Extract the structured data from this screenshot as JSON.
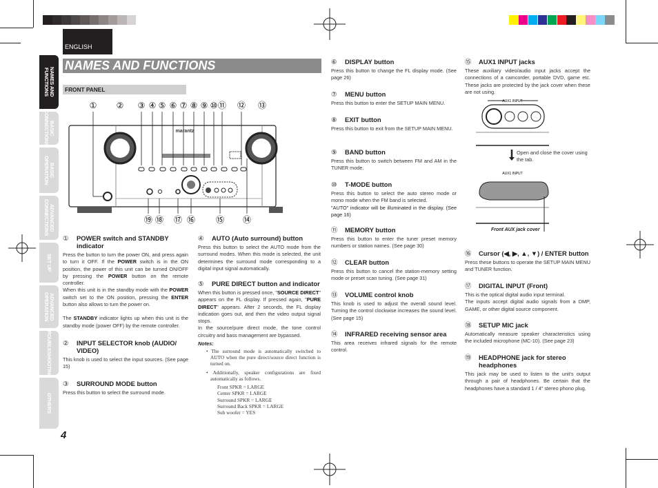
{
  "colors": {
    "grayscale": [
      "#231f20",
      "#2f2b2c",
      "#3d3839",
      "#4e4849",
      "#5f5859",
      "#756d6e",
      "#8c8485",
      "#a39c9d",
      "#bcb6b7",
      "#d7d2d3"
    ],
    "process": [
      "#fff200",
      "#ec008c",
      "#00aeef",
      "#2e3192",
      "#00a651",
      "#ed1c24",
      "#231f20",
      "#fff57a",
      "#f68fc8",
      "#7dd8f7",
      "#8c8c8c"
    ]
  },
  "header": {
    "language": "ENGLISH",
    "title": "NAMES AND FUNCTIONS",
    "section": "FRONT PANEL"
  },
  "side_tabs": [
    "NAMES AND FUNCTIONS",
    "BASIC CONNECTIONS",
    "BASIC OPERATION",
    "ADVANCED CONNECTIONS",
    "SET UP",
    "ADVANCED OPERATION",
    "TROUBLESHOOTING",
    "OTHERS"
  ],
  "diagram": {
    "callouts_top": [
      "①",
      "②",
      "③",
      "④",
      "⑤",
      "⑥",
      "⑦",
      "⑧",
      "⑨",
      "⑩",
      "⑪",
      "⑫",
      "⑬"
    ],
    "callouts_bottom": [
      "⑲",
      "⑱",
      "⑰",
      "⑯",
      "⑮",
      "⑭"
    ],
    "brand": "marantz"
  },
  "items": [
    {
      "num": "①",
      "title": "POWER switch and STANDBY indicator",
      "body": [
        "Press the button to turn the power ON, and press again to turn it OFF. If the POWER switch is in the ON position, the power of this unit can be turned ON/OFF by pressing the POWER button on the remote controller.",
        "When this unit is in the standby mode with the POWER switch set to the ON position, pressing the ENTER button also allows to turn the power on.",
        "The STANDBY indicator lights up when this unit is the standby mode (power OFF) by the remote controller."
      ]
    },
    {
      "num": "②",
      "title": "INPUT SELECTOR knob (AUDIO/ VIDEO)",
      "body": [
        "This knob is used to select the input sources. (See page 15)"
      ]
    },
    {
      "num": "③",
      "title": "SURROUND MODE button",
      "body": [
        "Press this button to select the surround mode."
      ]
    },
    {
      "num": "④",
      "title": "AUTO (Auto surround) button",
      "body": [
        "Press this button to select the AUTO mode from the surround modes. When this mode is selected, the unit determines the surround mode corresponding to a digital input signal automatically."
      ]
    },
    {
      "num": "⑤",
      "title": "PURE DIRECT button and indicator",
      "body": [
        "When this button is pressed once, \"SOURCE DIRECT\" appears on the FL display. If pressed again, \"PURE DIRECT\" appears. After 2 seconds, the FL display indication goes out, and then the video output signal stops.",
        "In the source/pure direct mode, the tone control circuitry and bass management are bypassed."
      ],
      "notes_label": "Notes:",
      "notes": [
        "The surround mode is automatically switched to AUTO when the pure direct/source direct function is turned on.",
        "Additionally, speaker configurations are fixed automatically as follows."
      ],
      "speakers": [
        "Front SPKR = LARGE",
        "Center SPKR = LARGE",
        "Surround SPKR = LARGE",
        "Surround Back SPKR = LARGE",
        "Sub woofer = YES"
      ]
    },
    {
      "num": "⑥",
      "title": "DISPLAY button",
      "body": [
        "Press this button to change the FL display mode. (See page 26)"
      ]
    },
    {
      "num": "⑦",
      "title": "MENU button",
      "body": [
        "Press this button to enter the SETUP MAIN MENU."
      ]
    },
    {
      "num": "⑧",
      "title": "EXIT button",
      "body": [
        "Press this button to exit from the SETUP MAIN MENU."
      ]
    },
    {
      "num": "⑨",
      "title": "BAND button",
      "body": [
        "Press this button to switch between FM and AM in the TUNER mode."
      ]
    },
    {
      "num": "⑩",
      "title": "T-MODE button",
      "body": [
        "Press this button to select the auto stereo mode or mono mode when the FM band is selected.",
        "\"AUTO\" indicator will be illuminated in the display. (See page 16)"
      ]
    },
    {
      "num": "⑪",
      "title": "MEMORY button",
      "body": [
        "Press this button to enter the tuner preset memory numbers or station names. (See page 30)"
      ]
    },
    {
      "num": "⑫",
      "title": "CLEAR button",
      "body": [
        "Press this button to cancel the station-memory setting mode or preset scan tuning. (See page 31)"
      ]
    },
    {
      "num": "⑬",
      "title": "VOLUME control knob",
      "body": [
        "This knob is used to adjust the overall sound level. Turning the control clockwise increases the sound level. (See page 15)"
      ]
    },
    {
      "num": "⑭",
      "title": "INFRARED receiving sensor area",
      "body": [
        "This area receives infrared signals for the remote control."
      ]
    },
    {
      "num": "⑮",
      "title": "AUX1 INPUT jacks",
      "body": [
        "These auxiliary video/audio input jacks accept the connections of a camcorder, portable DVD, game etc. These jacks are protected by the jack cover when these are not using."
      ],
      "fig_label": "AUX1 INPUT",
      "fig_note": "Open and close the cover using the tab.",
      "fig_caption": "Front AUX jack cover"
    },
    {
      "num": "⑯",
      "title": "Cursor (◀, ▶, ▲, ▼) / ENTER button",
      "body": [
        "Press these buttons to operate the SETUP MAIN MENU and TUNER function."
      ]
    },
    {
      "num": "⑰",
      "title": "DIGITAL INPUT (Front)",
      "body": [
        "This is the optical digital audio input terminal.",
        "The inputs accept digital audio signals from a DMP, GAME, or other digital source component."
      ]
    },
    {
      "num": "⑱",
      "title": "SETUP MIC jack",
      "body": [
        "Automatically measure speaker characteristics using the included microphone (MC-10). (See page 23)"
      ]
    },
    {
      "num": "⑲",
      "title": "HEADPHONE jack for stereo headphones",
      "body": [
        "This jack may be used to listen to the unit's output through a pair of headphones. Be certain that the headphones have a standard 1 / 4\" stereo phono plug."
      ]
    }
  ],
  "page_number": "4"
}
